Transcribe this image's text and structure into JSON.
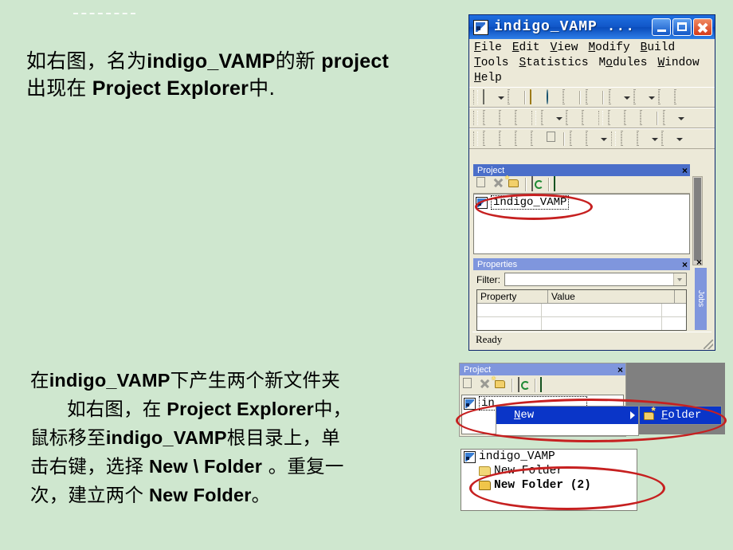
{
  "slide": {
    "background_color": "#cfe7cf",
    "paragraph_1": {
      "line_1_a": "如右图，名为",
      "line_1_b": "indigo_VAMP",
      "line_1_c": "的新",
      "line_1_d": "project",
      "line_2_a": "出现在",
      "line_2_b": "Project Explorer",
      "line_2_c": "中."
    },
    "paragraph_2": {
      "line_1_a": "在",
      "line_1_b": "indigo_VAMP",
      "line_1_c": "下产生两个新文件夹",
      "line_2_a": "如右图，在",
      "line_2_b": "Project Explorer",
      "line_2_c": "中，",
      "line_3_a": "鼠标移至",
      "line_3_b": "indigo_VAMP",
      "line_3_c": "根目录上，单",
      "line_4_a": "击右键，选择",
      "line_4_b": "New \\ Folder",
      "line_4_c": " 。重复一",
      "line_5_a": "次，建立两个",
      "line_5_b": "New Folder",
      "line_5_c": "。"
    }
  },
  "main_window": {
    "title": "indigo_VAMP ...",
    "title_icon": "project-icon",
    "window_buttons": {
      "minimize": "minimize-icon",
      "maximize": "maximize-icon",
      "close": "close-icon"
    },
    "menu": {
      "row_1": [
        "File",
        "Edit",
        "View",
        "Modify",
        "Build"
      ],
      "row_2": [
        "Tools",
        "Statistics",
        "Modules",
        "Window"
      ],
      "row_3": [
        "Help"
      ]
    },
    "toolbars": {
      "row_1_icons": [
        "new-file-icon",
        "new-file-dropdown",
        "save-icon",
        "open-folder-icon",
        "globe-icon",
        "export-icon",
        "package-icon",
        "undo-icon",
        "undo-dropdown",
        "redo-icon",
        "redo-dropdown",
        "cut-icon",
        "copy-icon"
      ],
      "row_2_icons": [
        "schematic-icon",
        "simulate-icon",
        "netlist-icon",
        "chart-icon",
        "chart-dropdown",
        "sort-az-icon",
        "sort-za-icon",
        "step-back-icon",
        "step-forward-icon",
        "run-icon",
        "report-icon",
        "report-dropdown"
      ],
      "row_3_icons": [
        "add-cell-icon",
        "add-pin-icon",
        "add-port-icon",
        "add-instance-icon",
        "properties-icon",
        "place-icon",
        "route-icon",
        "route-dropdown",
        "draw-circle-icon",
        "draw-line-icon",
        "draw-line-dropdown",
        "draw-poly-icon",
        "draw-poly-dropdown"
      ]
    },
    "project_pane": {
      "title": "Project",
      "close_label": "×",
      "toolbar_icons": [
        "new-item-icon",
        "delete-icon",
        "new-folder-icon",
        "refresh-icon",
        "library-icon"
      ],
      "tree": [
        {
          "icon": "project-icon",
          "label": "indigo_VAMP",
          "selected": true
        }
      ]
    },
    "properties_pane": {
      "title": "Properties",
      "close_label": "×",
      "filter_label": "Filter:",
      "filter_value": "",
      "columns": [
        "Property",
        "Value"
      ],
      "rows": [
        [
          "",
          ""
        ],
        [
          "",
          ""
        ]
      ]
    },
    "side_tab": "Jobs",
    "side_tab_close": "×",
    "status_bar": "Ready"
  },
  "context_window": {
    "pane_title": "Project",
    "close_label": "×",
    "toolbar_icons": [
      "new-item-icon",
      "delete-icon",
      "new-folder-icon",
      "refresh-icon",
      "library-icon"
    ],
    "tree_item_partial": "in",
    "menu": {
      "item_label_pre": "",
      "item_label_underlined": "N",
      "item_label_rest": "ew",
      "has_submenu": true
    },
    "submenu": {
      "icon": "new-folder-icon",
      "label_underlined": "F",
      "label_rest": "older"
    }
  },
  "result_window": {
    "tree": [
      {
        "icon": "project-icon",
        "label": "indigo_VAMP",
        "indent": 0,
        "bold": false
      },
      {
        "icon": "folder-icon",
        "label": "New Folder",
        "indent": 1,
        "bold": false
      },
      {
        "icon": "folder-icon",
        "label": "New Folder (2)",
        "indent": 1,
        "bold": true
      }
    ]
  },
  "annotations": {
    "highlight_color": "#c62020",
    "ellipses": [
      {
        "name": "highlight-project-node"
      },
      {
        "name": "highlight-new-folder-menu"
      },
      {
        "name": "highlight-created-folders"
      }
    ]
  }
}
